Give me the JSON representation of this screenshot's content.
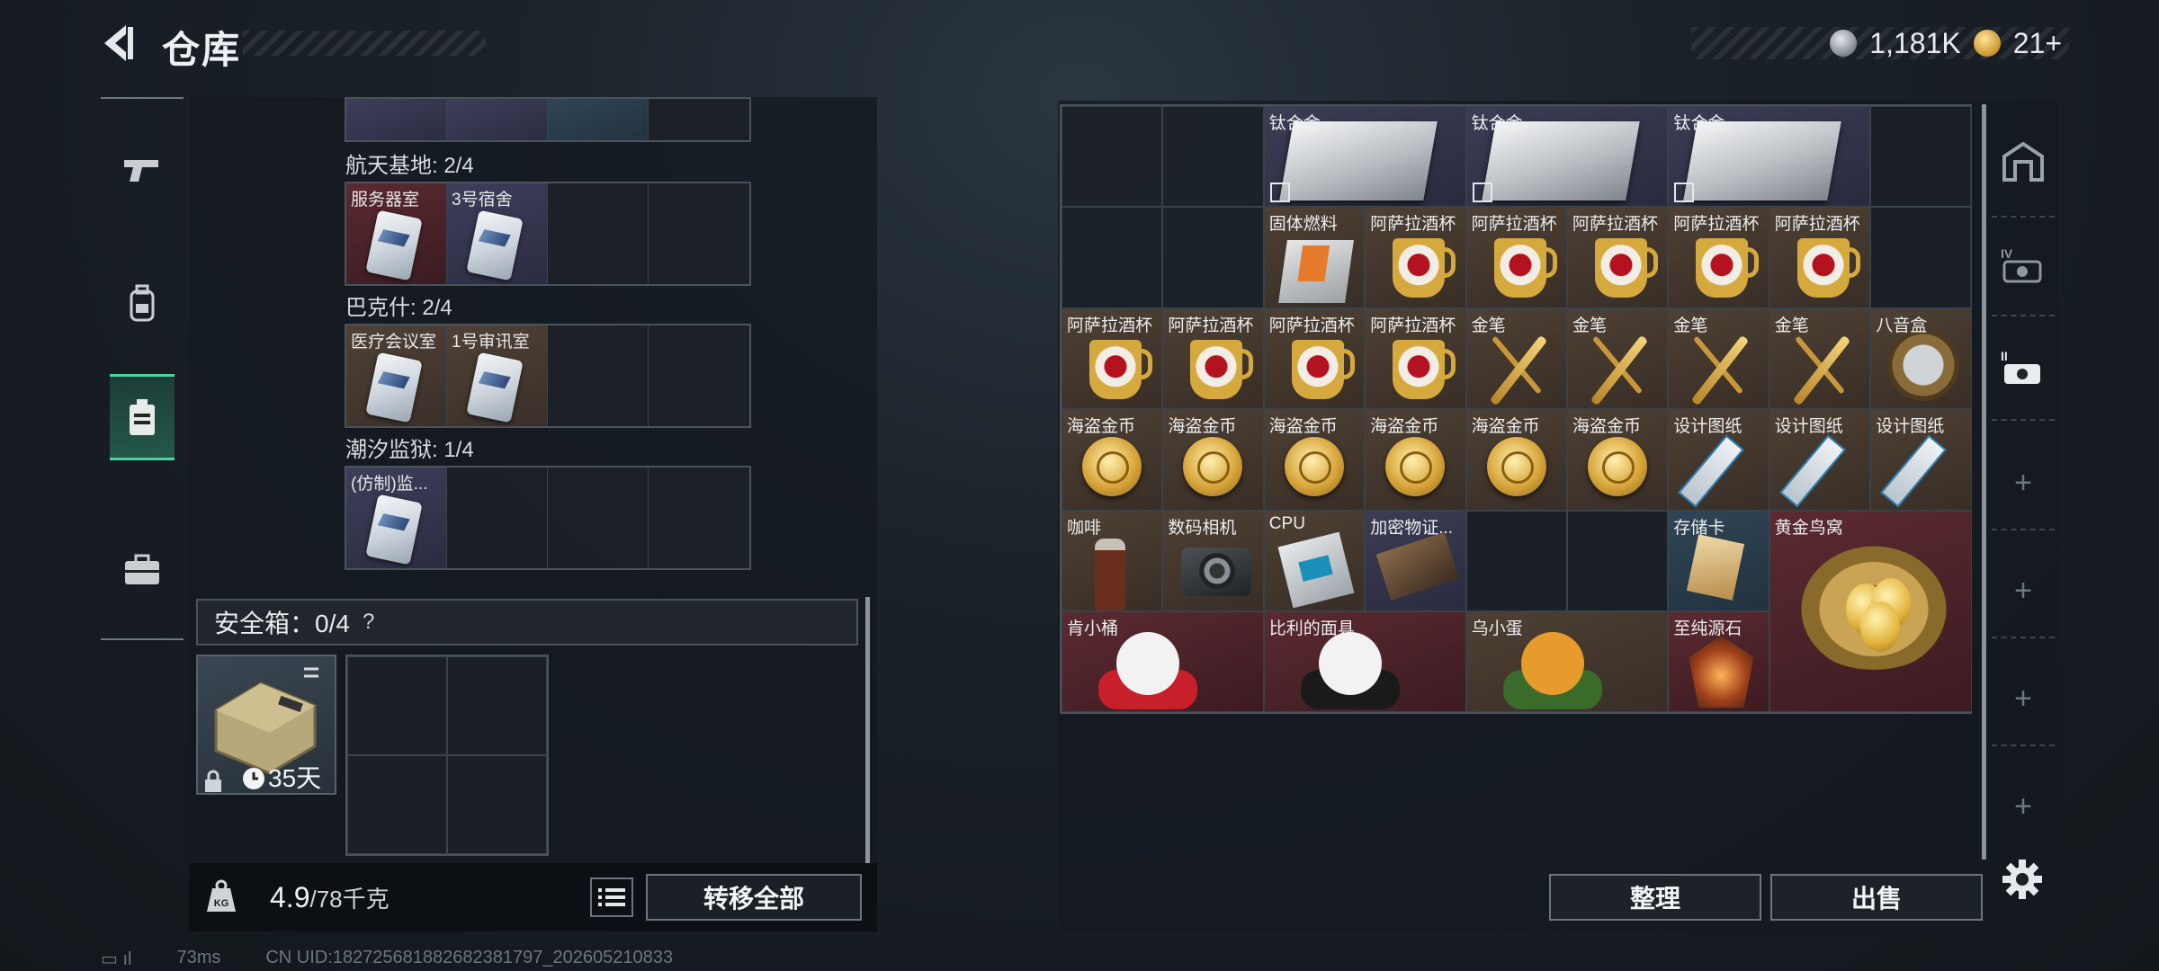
{
  "header": {
    "title": "仓库",
    "currency": [
      {
        "icon": "silver-coin-icon",
        "value": "1,181K"
      },
      {
        "icon": "gold-coin-icon",
        "value": "21+"
      }
    ]
  },
  "left_nav": {
    "items": [
      {
        "name": "weapons",
        "icon": "pistol-icon"
      },
      {
        "name": "equipment",
        "icon": "backpack-icon"
      },
      {
        "name": "keycards",
        "icon": "keycard-holder-icon",
        "active": true
      },
      {
        "name": "toolbox",
        "icon": "briefcase-icon"
      }
    ]
  },
  "key_sections": [
    {
      "label": "航天基地: 2/4",
      "cells": [
        {
          "name": "服务器室",
          "color": "red"
        },
        {
          "name": "3号宿舍",
          "color": "purple"
        },
        {
          "name": "",
          "color": "empty"
        },
        {
          "name": "",
          "color": "empty"
        }
      ]
    },
    {
      "label": "巴克什: 2/4",
      "cells": [
        {
          "name": "医疗会议室",
          "color": "brown"
        },
        {
          "name": "1号审讯室",
          "color": "brown"
        },
        {
          "name": "",
          "color": "empty"
        },
        {
          "name": "",
          "color": "empty"
        }
      ]
    },
    {
      "label": "潮汐监狱: 1/4",
      "cells": [
        {
          "name": "(仿制)监...",
          "color": "purple"
        },
        {
          "name": "",
          "color": "empty"
        },
        {
          "name": "",
          "color": "empty"
        },
        {
          "name": "",
          "color": "empty"
        }
      ]
    }
  ],
  "safebox": {
    "title": "安全箱：0/4",
    "help": "?",
    "days": "35天"
  },
  "weight": {
    "current": "4.9",
    "max": "/78千克"
  },
  "buttons": {
    "transfer_all": "转移全部",
    "sort": "整理",
    "sell": "出售"
  },
  "status": {
    "ping": "73ms",
    "uid": "CN UID:18272568188268238179​7_202605210833"
  },
  "storage": {
    "items": [
      {
        "name": "钛合金",
        "icon": "ingot",
        "bg": "purple",
        "col": 2,
        "row": 0,
        "w": 2,
        "h": 1,
        "nobind": true
      },
      {
        "name": "钛合金",
        "icon": "ingot",
        "bg": "purple",
        "col": 4,
        "row": 0,
        "w": 2,
        "h": 1,
        "nobind": true
      },
      {
        "name": "钛合金",
        "icon": "ingot",
        "bg": "purple",
        "col": 6,
        "row": 0,
        "w": 2,
        "h": 1,
        "nobind": true
      },
      {
        "name": "固体燃料",
        "icon": "fuel",
        "bg": "brown",
        "col": 2,
        "row": 1,
        "w": 1,
        "h": 1
      },
      {
        "name": "阿萨拉酒杯",
        "icon": "cup",
        "bg": "brown",
        "col": 3,
        "row": 1,
        "w": 1,
        "h": 1
      },
      {
        "name": "阿萨拉酒杯",
        "icon": "cup",
        "bg": "brown",
        "col": 4,
        "row": 1,
        "w": 1,
        "h": 1
      },
      {
        "name": "阿萨拉酒杯",
        "icon": "cup",
        "bg": "brown",
        "col": 5,
        "row": 1,
        "w": 1,
        "h": 1
      },
      {
        "name": "阿萨拉酒杯",
        "icon": "cup",
        "bg": "brown",
        "col": 6,
        "row": 1,
        "w": 1,
        "h": 1
      },
      {
        "name": "阿萨拉酒杯",
        "icon": "cup",
        "bg": "brown",
        "col": 7,
        "row": 1,
        "w": 1,
        "h": 1
      },
      {
        "name": "阿萨拉酒杯",
        "icon": "cup",
        "bg": "brown",
        "col": 0,
        "row": 2,
        "w": 1,
        "h": 1
      },
      {
        "name": "阿萨拉酒杯",
        "icon": "cup",
        "bg": "brown",
        "col": 1,
        "row": 2,
        "w": 1,
        "h": 1
      },
      {
        "name": "阿萨拉酒杯",
        "icon": "cup",
        "bg": "brown",
        "col": 2,
        "row": 2,
        "w": 1,
        "h": 1
      },
      {
        "name": "阿萨拉酒杯",
        "icon": "cup",
        "bg": "brown",
        "col": 3,
        "row": 2,
        "w": 1,
        "h": 1
      },
      {
        "name": "金笔",
        "icon": "pen",
        "bg": "brown",
        "col": 4,
        "row": 2,
        "w": 1,
        "h": 1
      },
      {
        "name": "金笔",
        "icon": "pen",
        "bg": "brown",
        "col": 5,
        "row": 2,
        "w": 1,
        "h": 1
      },
      {
        "name": "金笔",
        "icon": "pen",
        "bg": "brown",
        "col": 6,
        "row": 2,
        "w": 1,
        "h": 1
      },
      {
        "name": "金笔",
        "icon": "pen",
        "bg": "brown",
        "col": 7,
        "row": 2,
        "w": 1,
        "h": 1
      },
      {
        "name": "八音盒",
        "icon": "music-box",
        "bg": "brown",
        "col": 8,
        "row": 2,
        "w": 1,
        "h": 1
      },
      {
        "name": "海盗金币",
        "icon": "coin",
        "bg": "brown",
        "col": 0,
        "row": 3,
        "w": 1,
        "h": 1
      },
      {
        "name": "海盗金币",
        "icon": "coin",
        "bg": "brown",
        "col": 1,
        "row": 3,
        "w": 1,
        "h": 1
      },
      {
        "name": "海盗金币",
        "icon": "coin",
        "bg": "brown",
        "col": 2,
        "row": 3,
        "w": 1,
        "h": 1
      },
      {
        "name": "海盗金币",
        "icon": "coin",
        "bg": "brown",
        "col": 3,
        "row": 3,
        "w": 1,
        "h": 1
      },
      {
        "name": "海盗金币",
        "icon": "coin",
        "bg": "brown",
        "col": 4,
        "row": 3,
        "w": 1,
        "h": 1
      },
      {
        "name": "海盗金币",
        "icon": "coin",
        "bg": "brown",
        "col": 5,
        "row": 3,
        "w": 1,
        "h": 1
      },
      {
        "name": "设计图纸",
        "icon": "blueprint",
        "bg": "brown",
        "col": 6,
        "row": 3,
        "w": 1,
        "h": 1
      },
      {
        "name": "设计图纸",
        "icon": "blueprint",
        "bg": "brown",
        "col": 7,
        "row": 3,
        "w": 1,
        "h": 1
      },
      {
        "name": "设计图纸",
        "icon": "blueprint",
        "bg": "brown",
        "col": 8,
        "row": 3,
        "w": 1,
        "h": 1
      },
      {
        "name": "咖啡",
        "icon": "coffee",
        "bg": "brown",
        "col": 0,
        "row": 4,
        "w": 1,
        "h": 1
      },
      {
        "name": "数码相机",
        "icon": "camera",
        "bg": "brown",
        "col": 1,
        "row": 4,
        "w": 1,
        "h": 1
      },
      {
        "name": "CPU",
        "icon": "cpu",
        "bg": "brown",
        "col": 2,
        "row": 4,
        "w": 1,
        "h": 1
      },
      {
        "name": "加密物证...",
        "icon": "crypto",
        "bg": "purple",
        "col": 3,
        "row": 4,
        "w": 1,
        "h": 1
      },
      {
        "name": "存储卡",
        "icon": "sdcard",
        "bg": "blue",
        "col": 6,
        "row": 4,
        "w": 1,
        "h": 1
      },
      {
        "name": "黄金鸟窝",
        "icon": "nest",
        "bg": "red",
        "col": 7,
        "row": 4,
        "w": 2,
        "h": 2
      },
      {
        "name": "肯小桶",
        "icon": "figure-kfc",
        "bg": "red",
        "col": 0,
        "row": 5,
        "w": 2,
        "h": 1
      },
      {
        "name": "比利的面具",
        "icon": "figure-billy",
        "bg": "red",
        "col": 2,
        "row": 5,
        "w": 2,
        "h": 1
      },
      {
        "name": "乌小蛋",
        "icon": "figure-egg",
        "bg": "brown",
        "col": 4,
        "row": 5,
        "w": 2,
        "h": 1
      },
      {
        "name": "至纯源石",
        "icon": "stone",
        "bg": "red",
        "col": 6,
        "row": 5,
        "w": 1,
        "h": 1
      }
    ]
  },
  "right_nav": {
    "items": [
      {
        "icon": "storage-building-icon"
      },
      {
        "icon": "collection-IV-icon"
      },
      {
        "icon": "collection-II-icon",
        "active": true
      },
      {
        "icon": "plus-icon"
      },
      {
        "icon": "plus-icon"
      },
      {
        "icon": "plus-icon"
      },
      {
        "icon": "plus-icon"
      }
    ]
  }
}
